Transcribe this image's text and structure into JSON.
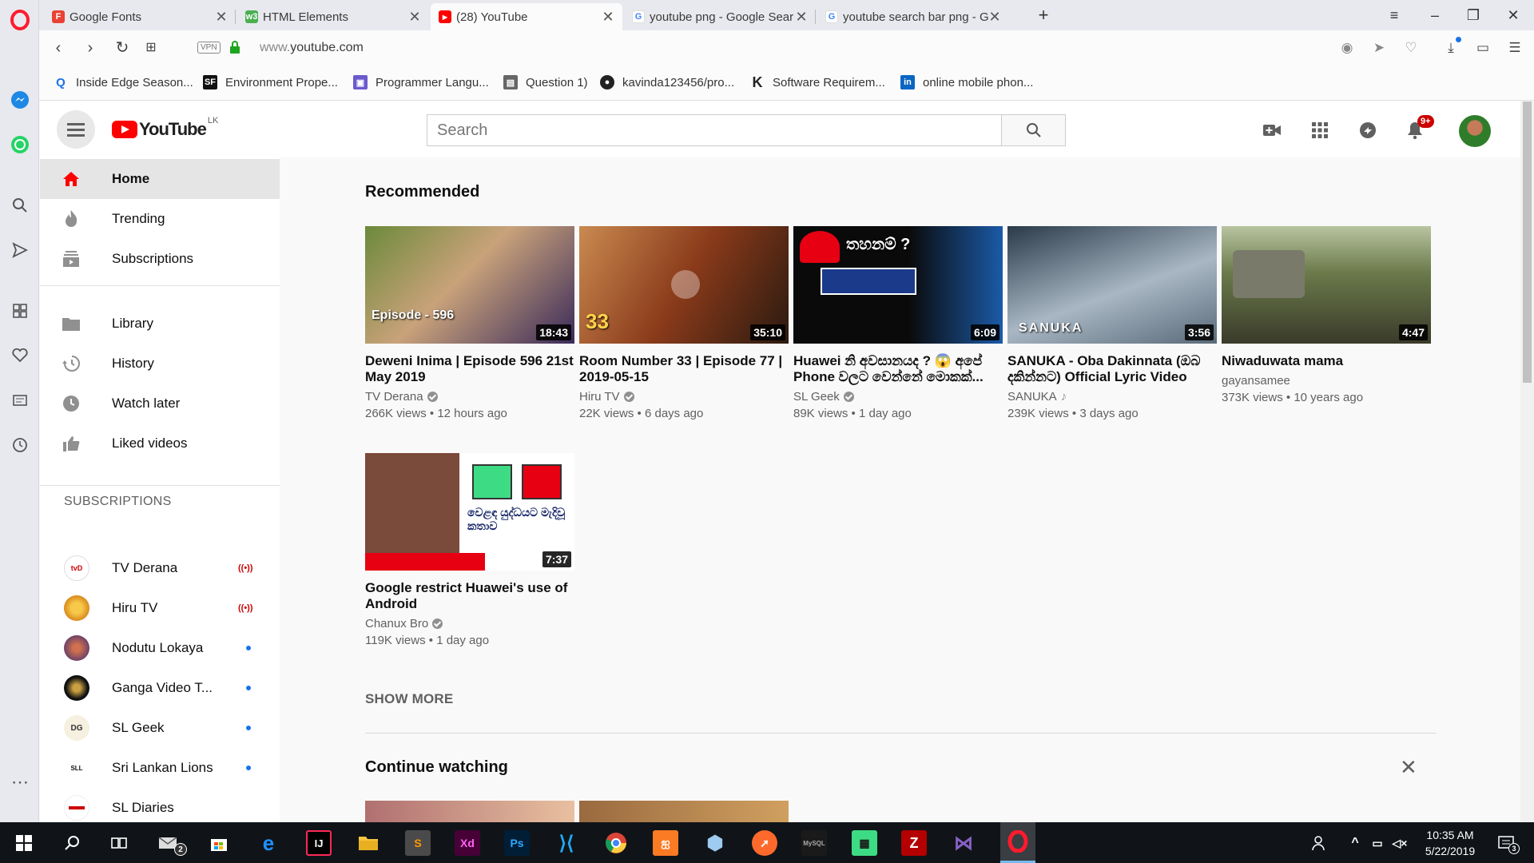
{
  "browser": {
    "tabs": [
      {
        "title": "Google Fonts",
        "favicon": "F",
        "color": "#e94235"
      },
      {
        "title": "HTML Elements",
        "favicon": "w3",
        "color": "#4caf50"
      },
      {
        "title": "(28) YouTube",
        "favicon": "▶",
        "color": "#ff0000"
      },
      {
        "title": "youtube png - Google Sear",
        "favicon": "G",
        "color": "#4285f4"
      },
      {
        "title": "youtube search bar png - G",
        "favicon": "G",
        "color": "#4285f4"
      }
    ],
    "url_prefix": "www.",
    "url_domain": "youtube.com",
    "vpn_label": "VPN",
    "bookmarks": [
      {
        "label": "Inside Edge Season...",
        "icon": "Q",
        "color": "#1a73e8"
      },
      {
        "label": "Environment Prope...",
        "icon": "SF",
        "color": "#111111"
      },
      {
        "label": "Programmer Langu...",
        "icon": "▣",
        "color": "#6a5acd"
      },
      {
        "label": "Question 1)",
        "icon": "▤",
        "color": "#555555"
      },
      {
        "label": "kavinda123456/pro...",
        "icon": "●",
        "color": "#222222"
      },
      {
        "label": "Software Requirem...",
        "icon": "K",
        "color": "#222222"
      },
      {
        "label": "online mobile phon...",
        "icon": "in",
        "color": "#0a66c2"
      }
    ]
  },
  "youtube": {
    "logo_text": "YouTube",
    "country_code": "LK",
    "search_placeholder": "Search",
    "notification_count": "9+",
    "guide": {
      "primary": [
        {
          "label": "Home",
          "icon": "home-icon"
        },
        {
          "label": "Trending",
          "icon": "flame-icon"
        },
        {
          "label": "Subscriptions",
          "icon": "subscriptions-icon"
        }
      ],
      "library": [
        {
          "label": "Library",
          "icon": "folder-icon"
        },
        {
          "label": "History",
          "icon": "history-icon"
        },
        {
          "label": "Watch later",
          "icon": "clock-icon"
        },
        {
          "label": "Liked videos",
          "icon": "thumb-up-icon"
        }
      ],
      "subscriptions_heading": "SUBSCRIPTIONS",
      "subscriptions": [
        {
          "label": "TV Derana",
          "status": "live",
          "avatar_text": "tvD",
          "color": "#ffffff"
        },
        {
          "label": "Hiru TV",
          "status": "live",
          "avatar_text": "",
          "color": "#e8a020"
        },
        {
          "label": "Nodutu Lokaya",
          "status": "new",
          "avatar_text": "",
          "color": "#8a4a6a"
        },
        {
          "label": "Ganga Video T...",
          "status": "new",
          "avatar_text": "",
          "color": "#111111"
        },
        {
          "label": "SL Geek",
          "status": "new",
          "avatar_text": "DG",
          "color": "#f5f0e0"
        },
        {
          "label": "Sri Lankan Lions",
          "status": "new",
          "avatar_text": "SLL",
          "color": "#ffffff"
        },
        {
          "label": "SL Diaries",
          "status": "",
          "avatar_text": "",
          "color": "#ffffff"
        }
      ],
      "live_indicator": "((•))"
    },
    "recommended_title": "Recommended",
    "videos": [
      {
        "title": "Deweni Inima | Episode 596 21st May 2019",
        "channel": "TV Derana",
        "verified": true,
        "views": "266K views",
        "age": "12 hours ago",
        "duration": "18:43",
        "overlay": "Episode - 596",
        "colors": [
          "#5c7a3a",
          "#c9a27a"
        ]
      },
      {
        "title": "Room Number 33 | Episode 77 | 2019-05-15",
        "channel": "Hiru TV",
        "verified": true,
        "views": "22K views",
        "age": "6 days ago",
        "duration": "35:10",
        "overlay": "33",
        "colors": [
          "#8a3a1a",
          "#d99060"
        ]
      },
      {
        "title": "Huawei නි අවසානයද ? 😱 අපේ Phone වලට වෙන්නේ මොකක්...",
        "channel": "SL Geek",
        "verified": true,
        "views": "89K views",
        "age": "1 day ago",
        "duration": "6:09",
        "overlay": "තහනම් ?",
        "colors": [
          "#0a0a0a",
          "#1b3a8a"
        ]
      },
      {
        "title": "SANUKA - Oba Dakinnata (ඔබ දකින්නට) Official Lyric Video",
        "channel": "SANUKA",
        "verified": false,
        "music": true,
        "views": "239K views",
        "age": "3 days ago",
        "duration": "3:56",
        "overlay": "SANUKA",
        "colors": [
          "#2a3a48",
          "#a9b7c4"
        ]
      },
      {
        "title": "Niwaduwata mama",
        "channel": "gayansamee",
        "verified": false,
        "views": "373K views",
        "age": "10 years ago",
        "duration": "4:47",
        "overlay": "",
        "colors": [
          "#4a5a3a",
          "#8a9a6a"
        ]
      },
      {
        "title": "Google restrict Huawei's use of Android",
        "channel": "Chanux Bro",
        "verified": true,
        "views": "119K views",
        "age": "1 day ago",
        "duration": "7:37",
        "overlay": "වෙළඳ යුද්ධයට මැදිවූ කතාව",
        "colors": [
          "#1a2a4a",
          "#e8e8f0"
        ]
      }
    ],
    "show_more": "SHOW MORE",
    "continue_watching_title": "Continue watching"
  },
  "taskbar": {
    "time": "10:35 AM",
    "date": "5/22/2019",
    "mail_badge": "2",
    "notif_badge": "3"
  }
}
